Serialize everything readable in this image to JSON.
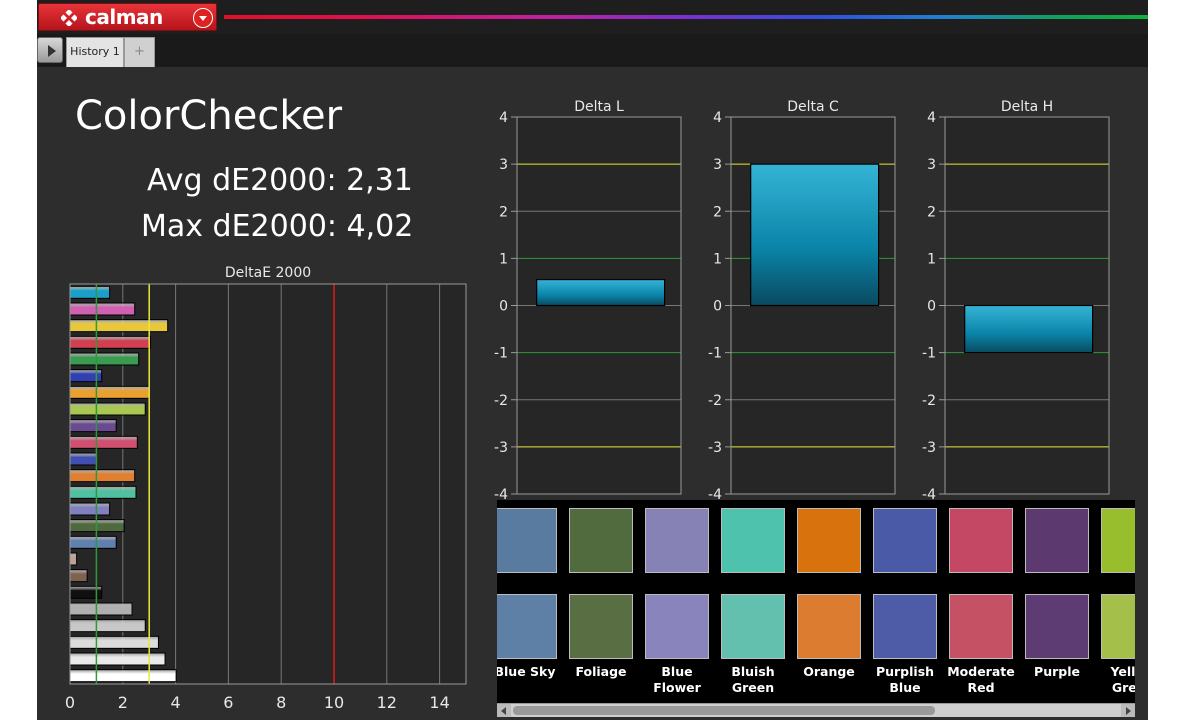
{
  "app": {
    "logo_text": "calman",
    "tab_label": "History 1",
    "brand_color": "#d6202a"
  },
  "summary": {
    "title": "ColorChecker",
    "avg": "Avg dE2000: 2,31",
    "max": "Max dE2000: 4,02"
  },
  "chart_data": [
    {
      "type": "bar",
      "orientation": "horizontal",
      "title": "DeltaE 2000",
      "xlim": [
        0,
        15
      ],
      "xticks": [
        "0",
        "2",
        "4",
        "6",
        "8",
        "10",
        "12",
        "14"
      ],
      "reference_lines": [
        {
          "value": 1,
          "color": "#2e9a3a"
        },
        {
          "value": 3,
          "color": "#e8e83a"
        },
        {
          "value": 10,
          "color": "#e01a1a"
        }
      ],
      "bars": [
        {
          "value": 1.5,
          "color": "#1aa0c8"
        },
        {
          "value": 2.45,
          "color": "#d060b0"
        },
        {
          "value": 3.7,
          "color": "#e8c83a"
        },
        {
          "value": 3.05,
          "color": "#d04050"
        },
        {
          "value": 2.6,
          "color": "#3a9a50"
        },
        {
          "value": 1.2,
          "color": "#3040b0"
        },
        {
          "value": 3.0,
          "color": "#e8a030"
        },
        {
          "value": 2.85,
          "color": "#a8c850"
        },
        {
          "value": 1.75,
          "color": "#6a4a90"
        },
        {
          "value": 2.55,
          "color": "#d05070"
        },
        {
          "value": 1.0,
          "color": "#4050b0"
        },
        {
          "value": 2.45,
          "color": "#e08030"
        },
        {
          "value": 2.5,
          "color": "#50c0a0"
        },
        {
          "value": 1.5,
          "color": "#8080c0"
        },
        {
          "value": 2.05,
          "color": "#506a40"
        },
        {
          "value": 1.75,
          "color": "#6080b0"
        },
        {
          "value": 0.25,
          "color": "#c0a090"
        },
        {
          "value": 0.65,
          "color": "#806050"
        },
        {
          "value": 1.2,
          "color": "#101010"
        },
        {
          "value": 2.35,
          "color": "#b0b0b0"
        },
        {
          "value": 2.85,
          "color": "#c8c8c8"
        },
        {
          "value": 3.35,
          "color": "#dcdcdc"
        },
        {
          "value": 3.6,
          "color": "#eaeaea"
        },
        {
          "value": 4.02,
          "color": "#ffffff"
        }
      ]
    },
    {
      "type": "bar",
      "title": "Delta L",
      "ylim": [
        -4,
        4
      ],
      "yticks": [
        "4",
        "3",
        "2",
        "1",
        "0",
        "-1",
        "-2",
        "-3",
        "-4"
      ],
      "values": [
        0.55
      ]
    },
    {
      "type": "bar",
      "title": "Delta C",
      "ylim": [
        -4,
        4
      ],
      "yticks": [
        "4",
        "3",
        "2",
        "1",
        "0",
        "-1",
        "-2",
        "-3",
        "-4"
      ],
      "values": [
        3.0
      ]
    },
    {
      "type": "bar",
      "title": "Delta H",
      "ylim": [
        -4,
        4
      ],
      "yticks": [
        "4",
        "3",
        "2",
        "1",
        "0",
        "-1",
        "-2",
        "-3",
        "-4"
      ],
      "values": [
        -1.0
      ]
    }
  ],
  "swatches": [
    {
      "label": "Blue Sky",
      "target": "#5a7ba0",
      "actual": "#5e80a6"
    },
    {
      "label": "Foliage",
      "target": "#516b3e",
      "actual": "#5a6e44"
    },
    {
      "label": "Blue Flower",
      "target": "#8782b6",
      "actual": "#8a84bc"
    },
    {
      "label": "Bluish Green",
      "target": "#4fc2ad",
      "actual": "#63c0ae"
    },
    {
      "label": "Orange",
      "target": "#d8720c",
      "actual": "#dc7c30"
    },
    {
      "label": "Purplish Blue",
      "target": "#4a5aa6",
      "actual": "#4e5ca8"
    },
    {
      "label": "Moderate Red",
      "target": "#c44864",
      "actual": "#c45264"
    },
    {
      "label": "Purple",
      "target": "#5c3a70",
      "actual": "#5c3c72"
    },
    {
      "label": "Yellow Green",
      "target": "#98be2e",
      "actual": "#a4c04a"
    }
  ]
}
